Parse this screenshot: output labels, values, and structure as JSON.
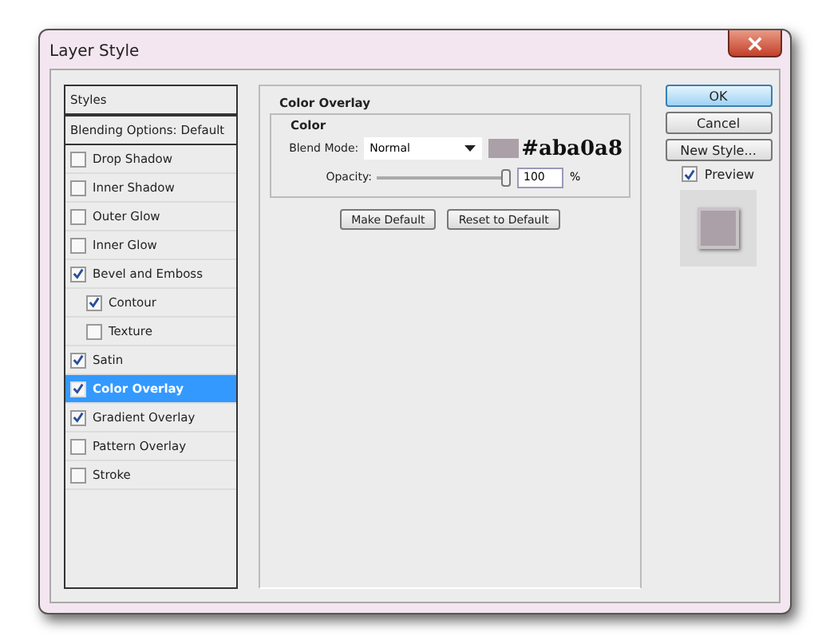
{
  "window": {
    "title": "Layer Style"
  },
  "styles_list": {
    "header": "Styles",
    "blending": "Blending Options: Default",
    "items": [
      {
        "label": "Drop Shadow",
        "checked": false,
        "selected": false
      },
      {
        "label": "Inner Shadow",
        "checked": false,
        "selected": false
      },
      {
        "label": "Outer Glow",
        "checked": false,
        "selected": false
      },
      {
        "label": "Inner Glow",
        "checked": false,
        "selected": false
      },
      {
        "label": "Bevel and Emboss",
        "checked": true,
        "selected": false,
        "children": [
          {
            "label": "Contour",
            "checked": true,
            "selected": false
          },
          {
            "label": "Texture",
            "checked": false,
            "selected": false
          }
        ]
      },
      {
        "label": "Satin",
        "checked": true,
        "selected": false
      },
      {
        "label": "Color Overlay",
        "checked": true,
        "selected": true
      },
      {
        "label": "Gradient Overlay",
        "checked": true,
        "selected": false
      },
      {
        "label": "Pattern Overlay",
        "checked": false,
        "selected": false
      },
      {
        "label": "Stroke",
        "checked": false,
        "selected": false
      }
    ]
  },
  "panel": {
    "title": "Color Overlay",
    "group": "Color",
    "blend_mode_label": "Blend Mode:",
    "blend_mode": "Normal",
    "color": "#aba0a8",
    "color_note": "#aba0a8",
    "opacity_label": "Opacity:",
    "opacity": {
      "level": 0.97
    },
    "opacity_value": "100",
    "opacity_unit": "%",
    "buttons": [
      "Make Default",
      "Reset to Default"
    ]
  },
  "actions": {
    "ok": "OK",
    "cancel": "Cancel",
    "new_style": "New Style...",
    "preview_label": "Preview",
    "preview_checked": true
  }
}
